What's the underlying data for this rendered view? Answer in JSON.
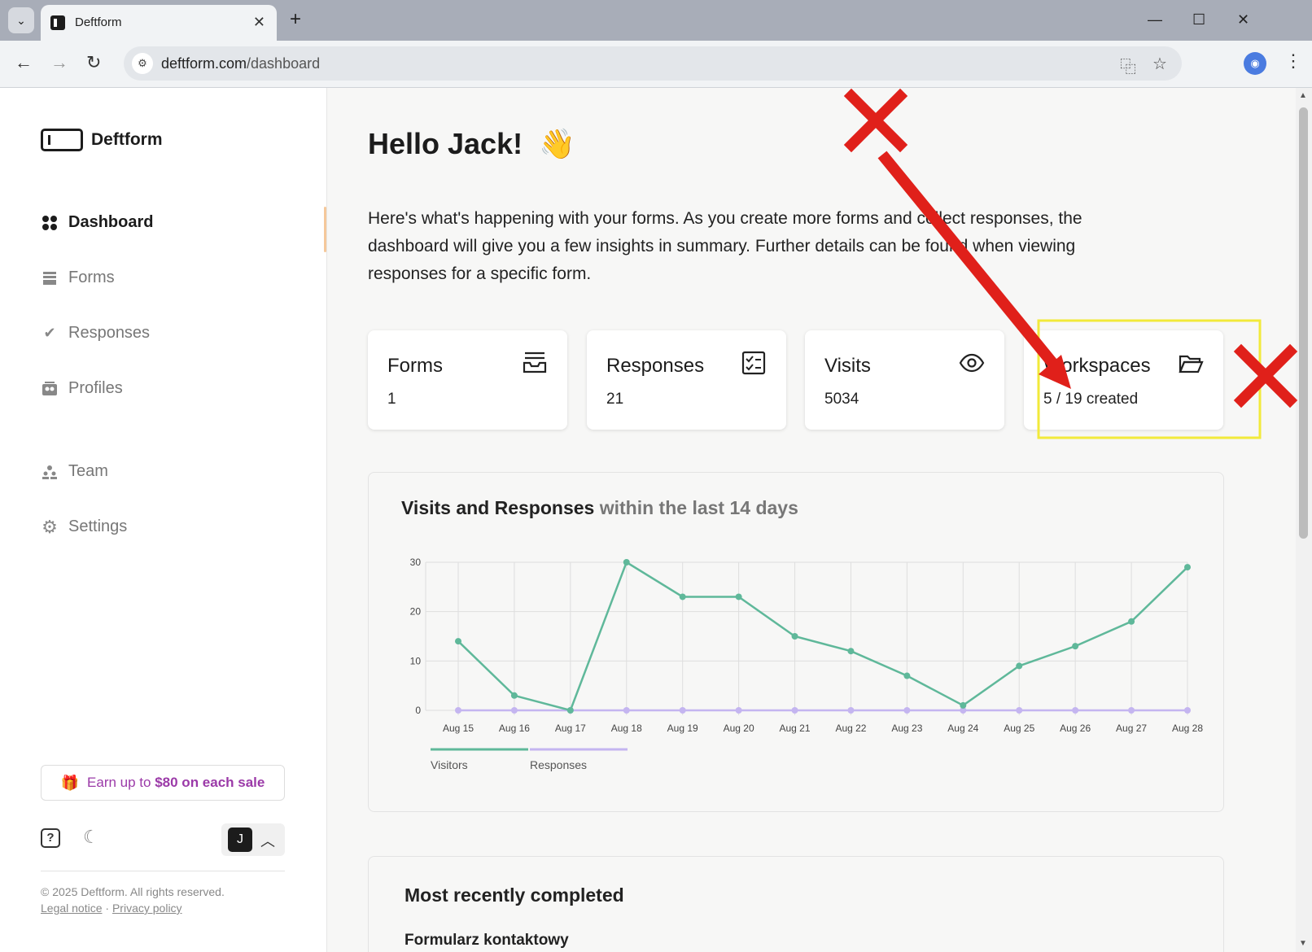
{
  "browser": {
    "tab_title": "Deftform",
    "url_host": "deftform.com",
    "url_path": "/dashboard"
  },
  "sidebar": {
    "brand": "Deftform",
    "nav": [
      {
        "label": "Dashboard",
        "icon": "grid-icon",
        "active": true
      },
      {
        "label": "Forms",
        "icon": "inbox-icon",
        "active": false
      },
      {
        "label": "Responses",
        "icon": "double-check-icon",
        "active": false
      },
      {
        "label": "Profiles",
        "icon": "contacts-icon",
        "active": false
      },
      {
        "label": "Team",
        "icon": "team-icon",
        "active": false
      },
      {
        "label": "Settings",
        "icon": "gear-icon",
        "active": false
      }
    ],
    "earn_prefix": "Earn up to ",
    "earn_amount": "$80 on each sale",
    "avatar_initial": "J",
    "copyright": "© 2025 Deftform. All rights reserved.",
    "legal_notice": "Legal notice",
    "legal_separator": " · ",
    "privacy_policy": "Privacy policy"
  },
  "main": {
    "greeting": "Hello Jack!",
    "greeting_emoji": "👋",
    "intro": "Here's what's happening with your forms. As you create more forms and collect responses, the dashboard will give you a few insights in summary. Further details can be found when viewing responses for a specific form.",
    "stats": [
      {
        "label": "Forms",
        "value": "1",
        "icon": "inbox-tray-icon"
      },
      {
        "label": "Responses",
        "value": "21",
        "icon": "checklist-icon"
      },
      {
        "label": "Visits",
        "value": "5034",
        "icon": "eye-icon"
      },
      {
        "label": "Workspaces",
        "value": "5 / 19 created",
        "icon": "folder-open-icon"
      }
    ],
    "chart_title": "Visits and Responses",
    "chart_title_muted": " within the last 14 days",
    "recent_title": "Most recently completed",
    "recent_first_row": "Formularz kontaktowy"
  },
  "chart_data": {
    "type": "line",
    "x": [
      "Aug 15",
      "Aug 16",
      "Aug 17",
      "Aug 18",
      "Aug 19",
      "Aug 20",
      "Aug 21",
      "Aug 22",
      "Aug 23",
      "Aug 24",
      "Aug 25",
      "Aug 26",
      "Aug 27",
      "Aug 28"
    ],
    "series": [
      {
        "name": "Visitors",
        "color": "#5fb89a",
        "values": [
          14,
          3,
          0,
          30,
          23,
          23,
          15,
          12,
          7,
          1,
          9,
          13,
          18,
          29
        ]
      },
      {
        "name": "Responses",
        "color": "#c4b5f0",
        "values": [
          0,
          0,
          0,
          0,
          0,
          0,
          0,
          0,
          0,
          0,
          0,
          0,
          0,
          0
        ]
      }
    ],
    "yticks": [
      0,
      10,
      20,
      30
    ],
    "ylim": [
      0,
      30
    ],
    "grid": true,
    "legend": "bottom-left"
  },
  "annotation": {
    "highlight_color": "#f2ea3a",
    "arrow_color": "#e0201a"
  }
}
